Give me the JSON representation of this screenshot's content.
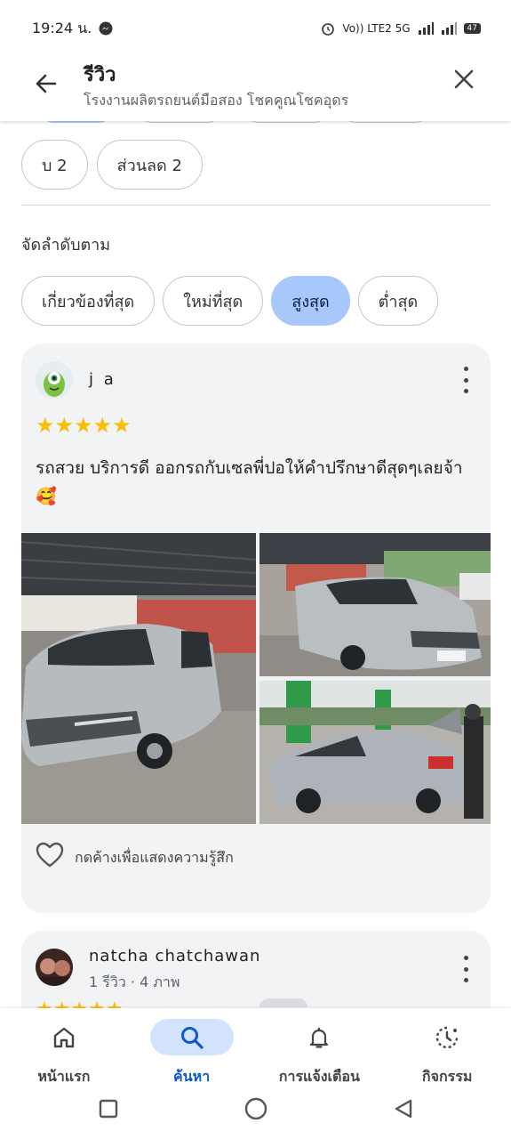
{
  "status_bar": {
    "time": "19:24 น.",
    "network": "Vo)) LTE2 5G",
    "battery": "47"
  },
  "header": {
    "title": "รีวิว",
    "subtitle": "โรงงานผลิตรถยนต์มือสอง โชคคูณโชคอุดร"
  },
  "filter_chips": [
    {
      "label": "บ 2"
    },
    {
      "label": "ส่วนลด 2"
    }
  ],
  "sort": {
    "label": "จัดลำดับตาม",
    "options": [
      {
        "label": "เกี่ยวข้องที่สุด",
        "selected": false
      },
      {
        "label": "ใหม่ที่สุด",
        "selected": false
      },
      {
        "label": "สูงสุด",
        "selected": true
      },
      {
        "label": "ต่ำสุด",
        "selected": false
      }
    ]
  },
  "review1": {
    "name": "j a",
    "rating": 5,
    "stars": "★★★★★",
    "text": "รถสวย บริการดี ออกรถกับเซลพี่ปอให้คำปรึกษาดีสุดๆเลยจ้า 🥰",
    "like_hint": "กดค้างเพื่อแสดงความรู้สึก"
  },
  "review2": {
    "name": "natcha chatchawan",
    "meta": "1 รีวิว · 4 ภาพ"
  },
  "bottom_nav": [
    {
      "label": "หน้าแรก",
      "icon": "home-icon",
      "active": false
    },
    {
      "label": "ค้นหา",
      "icon": "search-icon",
      "active": true
    },
    {
      "label": "การแจ้งเตือน",
      "icon": "bell-icon",
      "active": false
    },
    {
      "label": "กิจกรรม",
      "icon": "activity-icon",
      "active": false
    }
  ],
  "colors": {
    "accent": "#0b57d0",
    "selected_chip": "#a8c7fa",
    "star": "#fbbc04",
    "card_bg": "#f2f3f5"
  }
}
